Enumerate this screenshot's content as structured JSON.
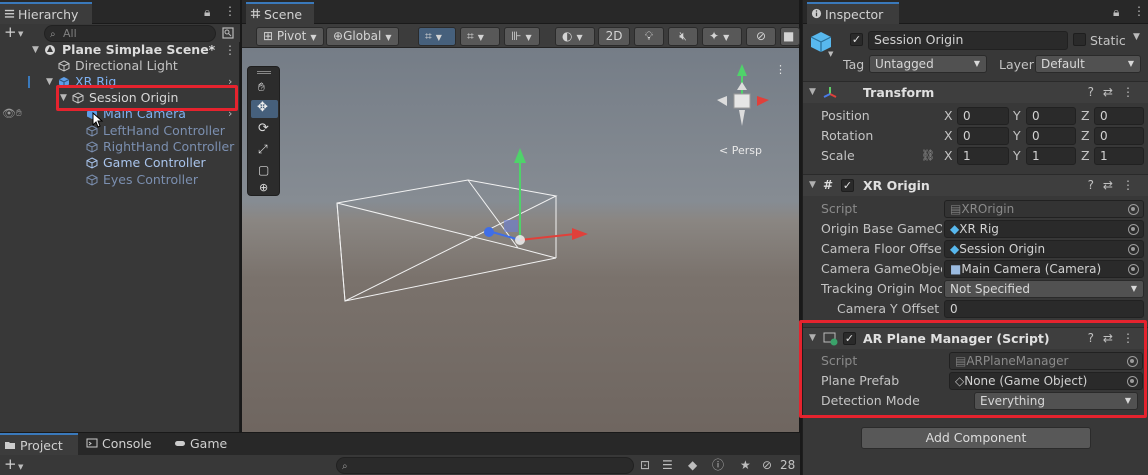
{
  "hierarchy": {
    "tab": "Hierarchy",
    "add_label": "+",
    "search_placeholder": "All",
    "scene_name": "Plane Simplae Scene*",
    "items": [
      {
        "label": "Directional Light"
      },
      {
        "label": "XR Rig"
      },
      {
        "label": "Session Origin"
      },
      {
        "label": "Main Camera"
      },
      {
        "label": "LeftHand Controller"
      },
      {
        "label": "RightHand Controller"
      },
      {
        "label": "Game Controller"
      },
      {
        "label": "Eyes Controller"
      }
    ]
  },
  "scene": {
    "tab": "Scene",
    "pivot": "Pivot",
    "global": "Global",
    "mode_2d": "2D",
    "persp_label": "< Persp"
  },
  "inspector": {
    "tab": "Inspector",
    "object_name": "Session Origin",
    "static_label": "Static",
    "tag_label": "Tag",
    "tag_value": "Untagged",
    "layer_label": "Layer",
    "layer_value": "Default",
    "transform": {
      "title": "Transform",
      "rows": [
        {
          "label": "Position",
          "x": "0",
          "y": "0",
          "z": "0"
        },
        {
          "label": "Rotation",
          "x": "0",
          "y": "0",
          "z": "0"
        },
        {
          "label": "Scale",
          "x": "1",
          "y": "1",
          "z": "1"
        }
      ],
      "axis_x": "X",
      "axis_y": "Y",
      "axis_z": "Z"
    },
    "xr_origin": {
      "title": "XR Origin",
      "script_label": "Script",
      "script_value": "XROrigin",
      "origin_label": "Origin Base GameObj",
      "origin_value": "XR Rig",
      "floor_label": "Camera Floor Offset (",
      "floor_value": "Session Origin",
      "camera_label": "Camera GameObject",
      "camera_value": "Main Camera (Camera)",
      "tracking_label": "Tracking Origin Mode",
      "tracking_value": "Not Specified",
      "yoffset_label": "Camera Y Offset",
      "yoffset_value": "0"
    },
    "ar_plane": {
      "title": "AR Plane Manager (Script)",
      "script_label": "Script",
      "script_value": "ARPlaneManager",
      "prefab_label": "Plane Prefab",
      "prefab_value": "None (Game Object)",
      "detection_label": "Detection Mode",
      "detection_value": "Everything"
    },
    "add_component": "Add Component"
  },
  "bottom": {
    "tabs": [
      "Project",
      "Console",
      "Game"
    ],
    "layer_count": "28"
  },
  "colors": {
    "selection_box": "#e5232e",
    "accent": "#3a79bb",
    "active_tool": "#46607c"
  }
}
